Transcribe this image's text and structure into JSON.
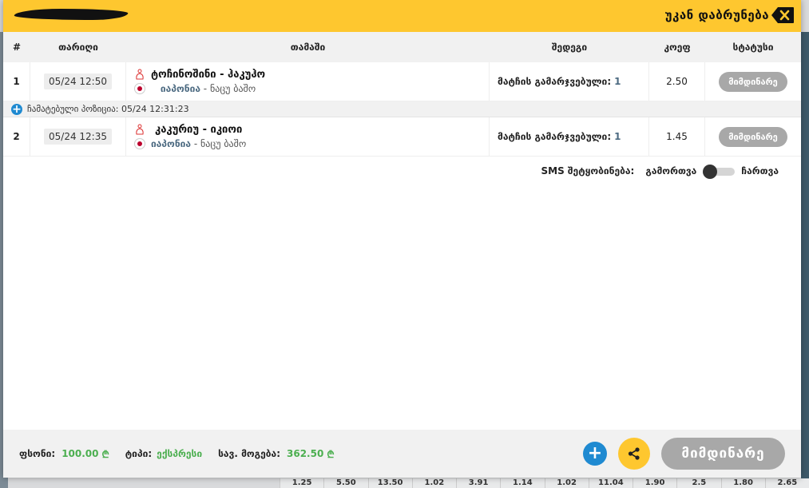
{
  "header": {
    "back_label": "უკან დაბრუნება"
  },
  "table": {
    "columns": [
      "#",
      "თარიღი",
      "თამაში",
      "შედეგი",
      "კოეფ",
      "სტატუსი"
    ],
    "rows": [
      {
        "num": "1",
        "date": "05/24 12:50",
        "game": "ტოჩინოშინი - ჰაკუჰო",
        "country": "იაპონია",
        "league": "ნაცუ ბაშო",
        "result_label": "მატჩის გამარჯვებული:",
        "result_value": "1",
        "odd": "2.50",
        "status": "მიმდინარე"
      },
      {
        "num": "2",
        "date": "05/24 12:35",
        "game": "კაკურიუ - იკიოი",
        "country": "იაპონია",
        "league": "ნაცუ ბაშო",
        "result_label": "მატჩის გამარჯვებული:",
        "result_value": "1",
        "odd": "1.45",
        "status": "მიმდინარე"
      }
    ],
    "inserted": "ჩამატებული პოზიცია: 05/24 12:31:23"
  },
  "sms": {
    "label": "SMS შეტყობინება:",
    "off": "გამორთვა",
    "on": "ჩართვა",
    "enabled": false
  },
  "footer": {
    "stake_label": "ფსონი:",
    "stake_value": "100.00",
    "currency": "₾",
    "type_label": "ტიპი:",
    "type_value": "ექსპრესი",
    "win_label": "სავ. მოგება:",
    "win_value": "362.50",
    "status_button": "მიმდინარე"
  },
  "background": {
    "odds": [
      "1.25",
      "5.50",
      "13.50",
      "1.02",
      "3.91",
      "1.14",
      "1.02",
      "11.04",
      "1.90",
      "2.5",
      "1.80",
      "2.65"
    ]
  },
  "colors": {
    "accent": "#fec72f",
    "plus": "#1f8ad1",
    "positive": "#4caf50",
    "status_grey": "#a8a8a8"
  }
}
